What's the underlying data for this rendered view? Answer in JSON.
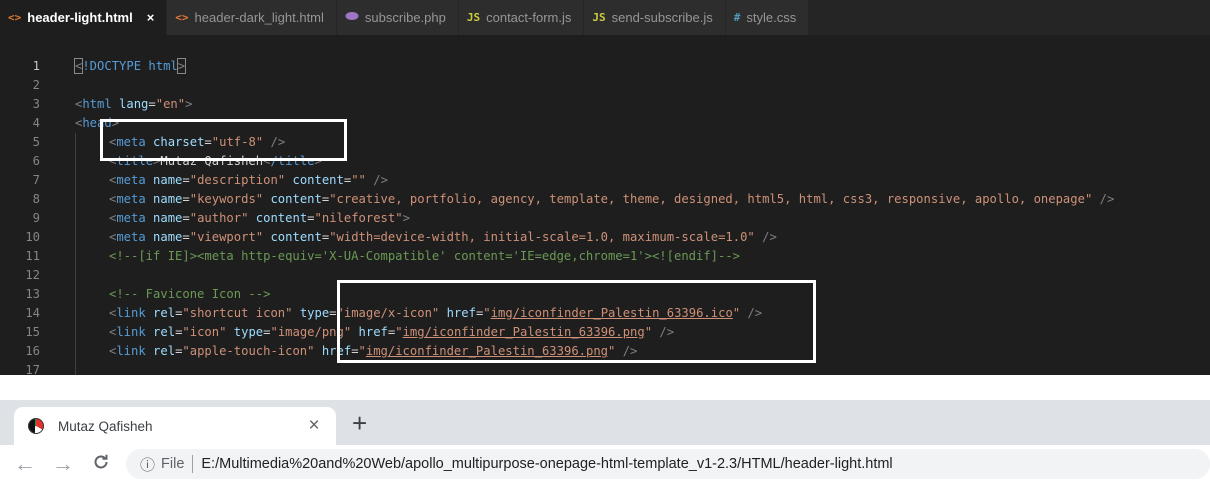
{
  "editor": {
    "tabs": [
      {
        "icon": "<>",
        "icon_color": "#e37933",
        "label": "header-light.html",
        "active": true,
        "close": "×"
      },
      {
        "icon": "<>",
        "icon_color": "#e37933",
        "label": "header-dark_light.html"
      },
      {
        "icon": "php",
        "icon_color": "#a074c4",
        "label": "subscribe.php"
      },
      {
        "icon": "JS",
        "icon_color": "#cbcb41",
        "label": "contact-form.js"
      },
      {
        "icon": "JS",
        "icon_color": "#cbcb41",
        "label": "send-subscribe.js"
      },
      {
        "icon": "#",
        "icon_color": "#519aba",
        "label": "style.css"
      }
    ],
    "line_numbers": [
      "1",
      "2",
      "3",
      "4",
      "5",
      "6",
      "7",
      "8",
      "9",
      "10",
      "11",
      "12",
      "13",
      "14",
      "15",
      "16",
      "17"
    ],
    "code": {
      "l1": {
        "open": "<",
        "doctype": "!DOCTYPE",
        "html": "html",
        "close": ">"
      },
      "l3": {
        "tag": "html",
        "attr": "lang",
        "val": "\"en\""
      },
      "l4": {
        "tag": "head"
      },
      "l5": {
        "tag": "meta",
        "attr": "charset",
        "val": "\"utf-8\"",
        "end": " />"
      },
      "l6": {
        "tag": "title",
        "text": "Mutaz Qafisheh",
        "endtag": "/title"
      },
      "l7": {
        "tag": "meta",
        "a1": "name",
        "v1": "\"description\"",
        "a2": "content",
        "v2": "\"\"",
        "end": " />"
      },
      "l8": {
        "tag": "meta",
        "a1": "name",
        "v1": "\"keywords\"",
        "a2": "content",
        "v2": "\"creative, portfolio, agency, template, theme, designed, html5, html, css3, responsive, apollo, onepage\"",
        "end": " />"
      },
      "l9": {
        "tag": "meta",
        "a1": "name",
        "v1": "\"author\"",
        "a2": "content",
        "v2": "\"nileforest\"",
        "end": ">"
      },
      "l10": {
        "tag": "meta",
        "a1": "name",
        "v1": "\"viewport\"",
        "a2": "content",
        "v2": "\"width=device-width, initial-scale=1.0, maximum-scale=1.0\"",
        "end": " />"
      },
      "l11": {
        "comment": "<!--[if IE]><meta http-equiv='X-UA-Compatible' content='IE=edge,chrome=1'><![endif]-->"
      },
      "l13": {
        "comment": "<!-- Favicone Icon -->"
      },
      "l14": {
        "tag": "link",
        "a1": "rel",
        "v1": "\"shortcut icon\"",
        "a2": "type",
        "v2": "\"image/x-icon\"",
        "a3": "href",
        "v3q": "\"",
        "v3": "img/iconfinder_Palestin_63396.ico",
        "end": " />"
      },
      "l15": {
        "tag": "link",
        "a1": "rel",
        "v1": "\"icon\"",
        "a2": "type",
        "v2": "\"image/png\"",
        "a3": "href",
        "v3q": "\"",
        "v3": "img/iconfinder_Palestin_63396.png",
        "end": " />"
      },
      "l16": {
        "tag": "link",
        "a1": "rel",
        "v1": "\"apple-touch-icon\"",
        "a3": "href",
        "v3q": "\"",
        "v3": "img/iconfinder_Palestin_63396.png",
        "end": " />"
      }
    }
  },
  "browser": {
    "tab_title": "Mutaz Qafisheh",
    "tab_close": "×",
    "new_tab": "+",
    "back": "←",
    "forward": "→",
    "reload": "C",
    "info": "ⓘ",
    "scheme_label": "File",
    "url": "E:/Multimedia%20and%20Web/apollo_multipurpose-onepage-html-template_v1-2.3/HTML/header-light.html"
  }
}
